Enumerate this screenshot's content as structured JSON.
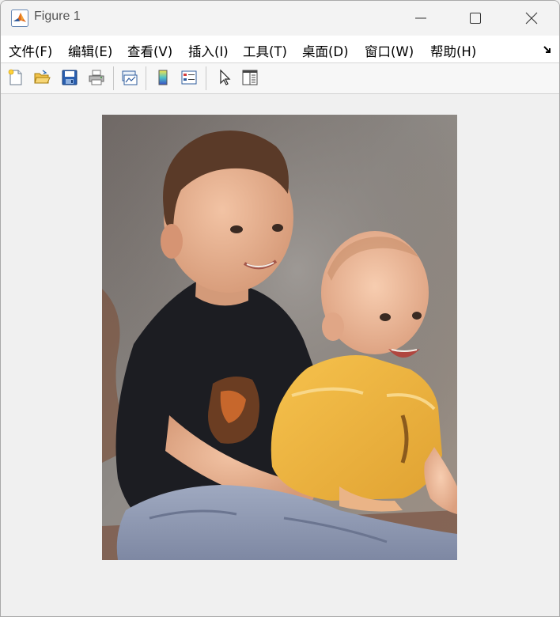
{
  "window": {
    "title": "Figure 1"
  },
  "menu": {
    "items": [
      {
        "label": "文件(F)"
      },
      {
        "label": "编辑(E)"
      },
      {
        "label": "查看(V)"
      },
      {
        "label": "插入(I)"
      },
      {
        "label": "工具(T)"
      },
      {
        "label": "桌面(D)"
      },
      {
        "label": "窗口(W)"
      },
      {
        "label": "帮助(H)"
      }
    ]
  },
  "toolbar": {
    "buttons": [
      {
        "icon": "new-figure-icon"
      },
      {
        "icon": "open-file-icon"
      },
      {
        "icon": "save-icon"
      },
      {
        "icon": "print-icon"
      },
      {
        "icon": "link-plot-icon"
      },
      {
        "icon": "insert-colorbar-icon"
      },
      {
        "icon": "insert-legend-icon"
      },
      {
        "icon": "pointer-icon"
      },
      {
        "icon": "property-inspector-icon"
      }
    ]
  },
  "image": {
    "description_icon": "photo-two-children"
  }
}
